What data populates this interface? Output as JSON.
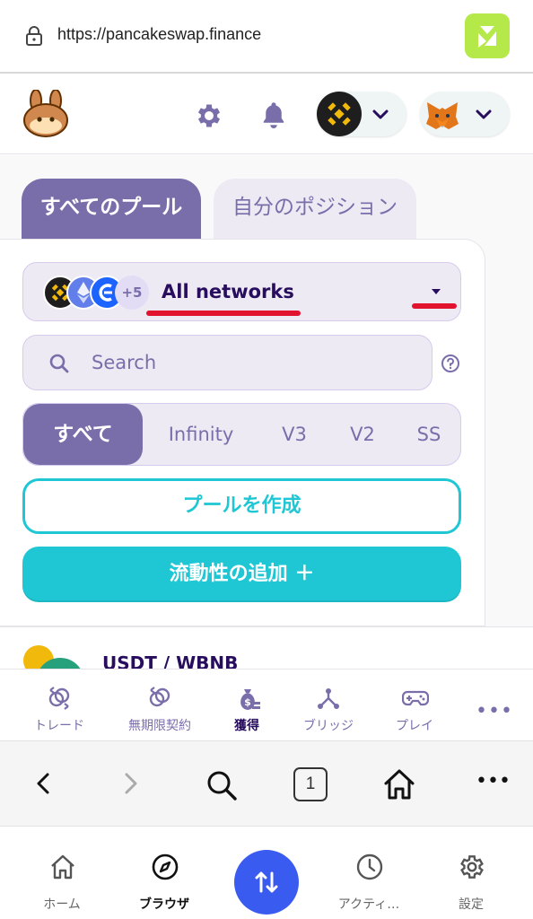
{
  "browser": {
    "url": "https://pancakeswap.finance"
  },
  "pool_tabs": {
    "all": "すべてのプール",
    "mine": "自分のポジション"
  },
  "network_selector": {
    "extra_count": "+5",
    "label": "All networks"
  },
  "search": {
    "placeholder": "Search"
  },
  "version_filter": [
    "すべて",
    "Infinity",
    "V3",
    "V2",
    "SS"
  ],
  "buttons": {
    "create_pool": "プールを作成",
    "add_liquidity": "流動性の追加 ＋"
  },
  "pool_row": {
    "pair": "USDT / WBNB"
  },
  "app_nav": [
    {
      "label": "トレード",
      "icon": "trade-icon"
    },
    {
      "label": "無期限契約",
      "icon": "perpetual-icon"
    },
    {
      "label": "獲得",
      "icon": "earn-icon"
    },
    {
      "label": "ブリッジ",
      "icon": "bridge-icon"
    },
    {
      "label": "プレイ",
      "icon": "gamepad-icon"
    }
  ],
  "browser_toolbar": {
    "tab_count": "1"
  },
  "wallet_nav": [
    {
      "label": "ホーム",
      "icon": "home-icon"
    },
    {
      "label": "ブラウザ",
      "icon": "compass-icon"
    },
    {
      "label": "アクティ…",
      "icon": "clock-icon"
    },
    {
      "label": "設定",
      "icon": "settings-icon"
    }
  ],
  "colors": {
    "primary": "#1fc7d4",
    "secondary": "#7a6eaa",
    "text": "#280d5f",
    "annotation_red": "#e2132f"
  }
}
